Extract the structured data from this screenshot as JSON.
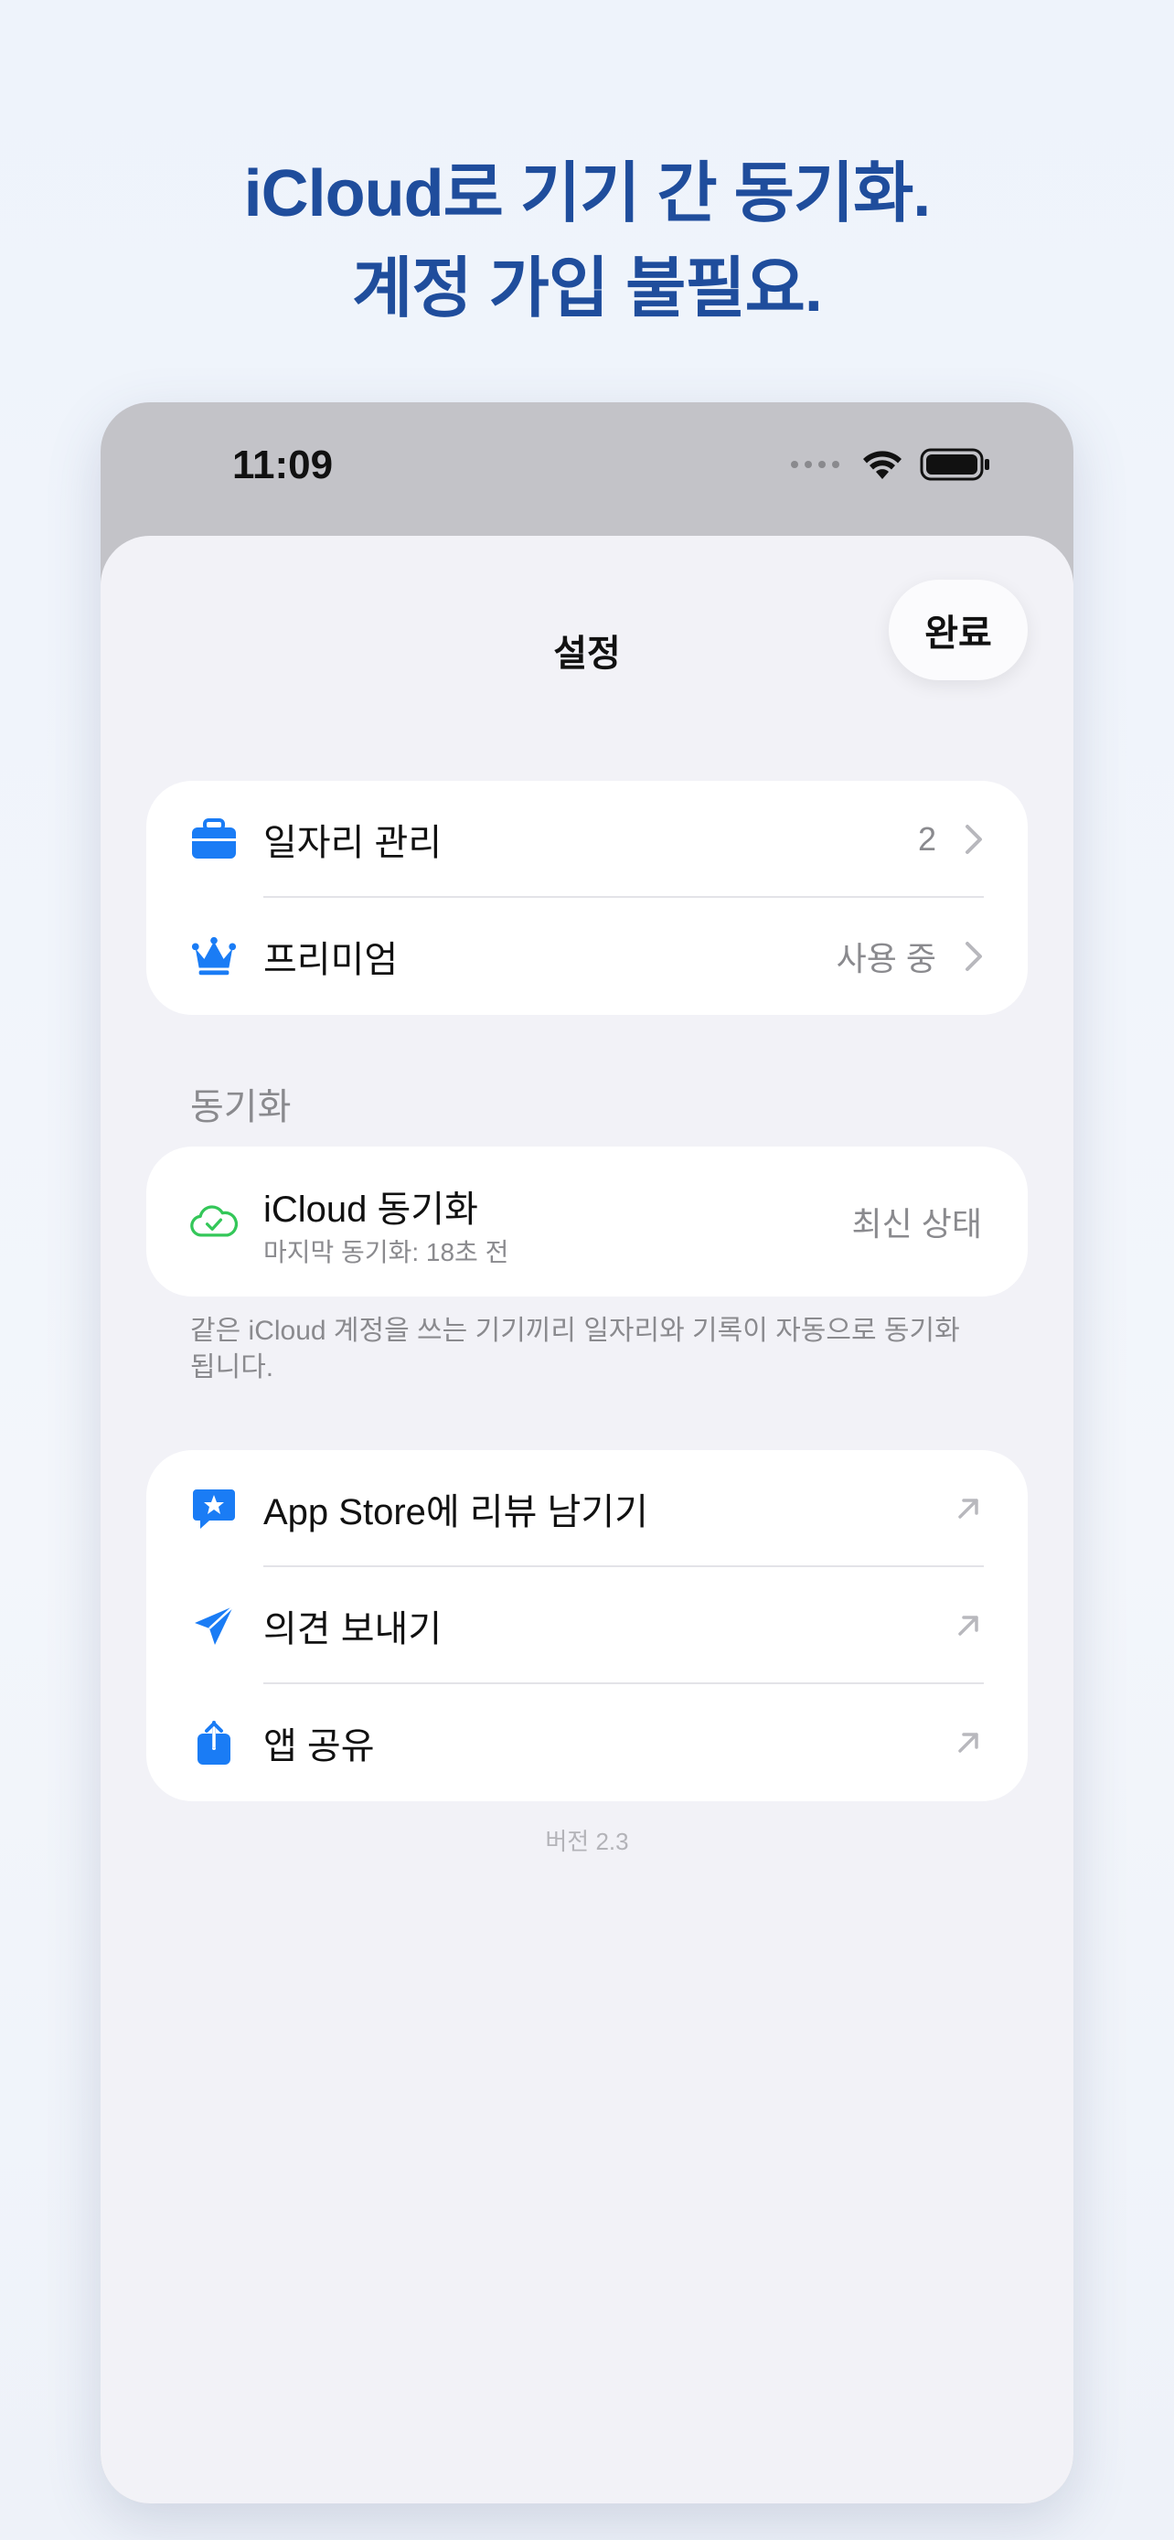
{
  "headline": {
    "line1": "iCloud로 기기 간 동기화.",
    "line2": "계정 가입 불필요."
  },
  "status_bar": {
    "time": "11:09"
  },
  "nav": {
    "title": "설정",
    "done_label": "완료"
  },
  "group1": {
    "items": [
      {
        "icon": "briefcase-icon",
        "label": "일자리 관리",
        "value": "2"
      },
      {
        "icon": "crown-icon",
        "label": "프리미엄",
        "value": "사용 중"
      }
    ]
  },
  "sync_section": {
    "header": "동기화",
    "icon": "cloud-check-icon",
    "title": "iCloud 동기화",
    "subtitle": "마지막 동기화: 18초 전",
    "status": "최신 상태",
    "footnote": "같은 iCloud 계정을 쓰는 기기끼리 일자리와 기록이 자동으로 동기화됩니다."
  },
  "group3": {
    "items": [
      {
        "icon": "star-bubble-icon",
        "label": "App Store에 리뷰 남기기"
      },
      {
        "icon": "paperplane-icon",
        "label": "의견 보내기"
      },
      {
        "icon": "share-icon",
        "label": "앱 공유"
      }
    ]
  },
  "version": "버전 2.3",
  "colors": {
    "accent": "#1a7cf5",
    "headline": "#1f4d9c",
    "sync_green": "#34c759"
  }
}
